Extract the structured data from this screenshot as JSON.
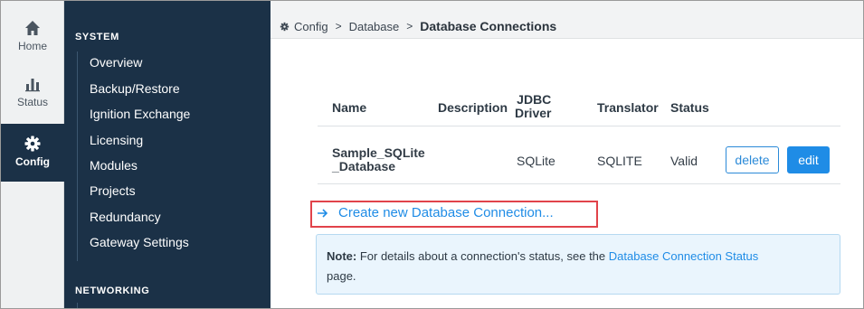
{
  "rail": {
    "home": "Home",
    "status": "Status",
    "config": "Config"
  },
  "sidebar": {
    "system_title": "SYSTEM",
    "items": [
      "Overview",
      "Backup/Restore",
      "Ignition Exchange",
      "Licensing",
      "Modules",
      "Projects",
      "Redundancy",
      "Gateway Settings"
    ],
    "networking_title": "NETWORKING"
  },
  "breadcrumb": {
    "root": "Config",
    "middle": "Database",
    "current": "Database Connections",
    "separator": ">"
  },
  "table": {
    "headers": {
      "name": "Name",
      "description": "Description",
      "jdbc_line1": "JDBC",
      "jdbc_line2": "Driver",
      "translator": "Translator",
      "status": "Status"
    },
    "rows": [
      {
        "name_line1": "Sample_SQLite",
        "name_line2": "_Database",
        "description": "",
        "driver": "SQLite",
        "translator": "SQLITE",
        "status": "Valid"
      }
    ],
    "delete_label": "delete",
    "edit_label": "edit"
  },
  "create_link": "Create new Database Connection...",
  "note": {
    "bold": "Note:",
    "text": " For details about a connection's status, see the ",
    "link": "Database Connection Status",
    "text_end": "page."
  },
  "colors": {
    "sidebar_bg": "#1b3147",
    "accent": "#1f8ce6",
    "highlight_box": "#e1434a",
    "note_bg": "#eaf5fd"
  },
  "icons": {
    "home": "home-icon",
    "status": "bar-chart-icon",
    "config": "gear-icon",
    "arrow": "arrow-right-icon"
  }
}
